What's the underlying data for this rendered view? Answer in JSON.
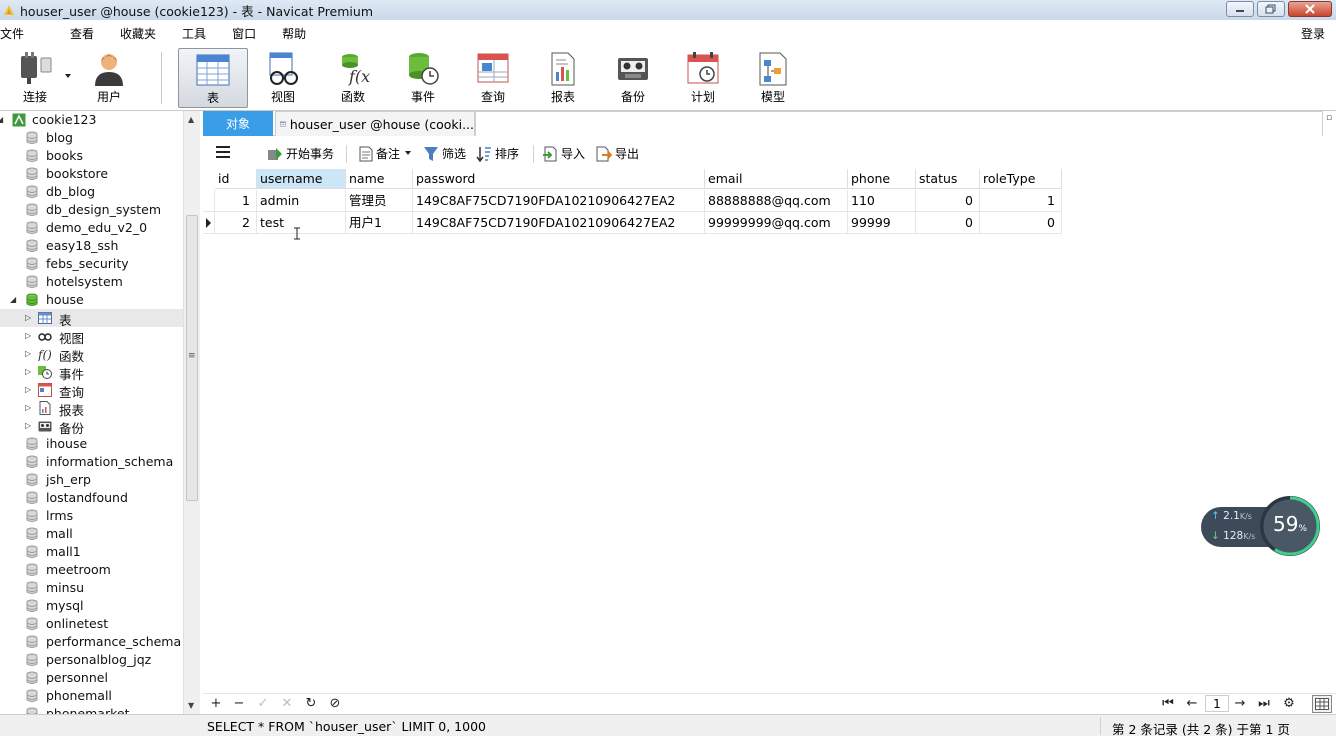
{
  "window": {
    "title": "houser_user @house (cookie123) - 表 - Navicat Premium"
  },
  "menu": [
    "文件",
    "查看",
    "收藏夹",
    "工具",
    "窗口",
    "帮助"
  ],
  "login_label": "登录",
  "toolbar": {
    "connect": "连接",
    "user": "用户",
    "table": "表",
    "view": "视图",
    "function": "函数",
    "event": "事件",
    "query": "查询",
    "report": "报表",
    "backup": "备份",
    "schedule": "计划",
    "model": "模型"
  },
  "sidebar": {
    "connection": "cookie123",
    "databases_before": [
      "blog",
      "books",
      "bookstore",
      "db_blog",
      "db_design_system",
      "demo_edu_v2_0",
      "easy18_ssh",
      "febs_security",
      "hotelsystem"
    ],
    "open_database": "house",
    "house_children": [
      "表",
      "视图",
      "函数",
      "事件",
      "查询",
      "报表",
      "备份"
    ],
    "databases_after": [
      "ihouse",
      "information_schema",
      "jsh_erp",
      "lostandfound",
      "lrms",
      "mall",
      "mall1",
      "meetroom",
      "minsu",
      "mysql",
      "onlinetest",
      "performance_schema",
      "personalblog_jqz",
      "personnel",
      "phonemall",
      "phonemarket"
    ]
  },
  "tabs": {
    "objects": "对象",
    "table_tab": "houser_user @house (cooki..."
  },
  "object_toolbar": {
    "begin_transaction": "开始事务",
    "memo": "备注",
    "filter": "筛选",
    "sort": "排序",
    "import": "导入",
    "export": "导出"
  },
  "grid": {
    "columns": [
      "id",
      "username",
      "name",
      "password",
      "email",
      "phone",
      "status",
      "roleType"
    ],
    "rows": [
      [
        "1",
        "admin",
        "管理员",
        "149C8AF75CD7190FDA10210906427EA2",
        "88888888@qq.com",
        "110",
        "0",
        "1"
      ],
      [
        "2",
        "test",
        "用户1",
        "149C8AF75CD7190FDA10210906427EA2",
        "99999999@qq.com",
        "99999",
        "0",
        "0"
      ]
    ]
  },
  "network": {
    "upload": "2.1",
    "upload_unit": "K/s",
    "download": "128",
    "download_unit": "K/s",
    "usage": "59",
    "usage_unit": "%"
  },
  "pagination": {
    "page": "1"
  },
  "status": {
    "sql": "SELECT * FROM `houser_user` LIMIT 0, 1000",
    "record_info": "第 2 条记录 (共 2 条) 于第 1 页"
  }
}
